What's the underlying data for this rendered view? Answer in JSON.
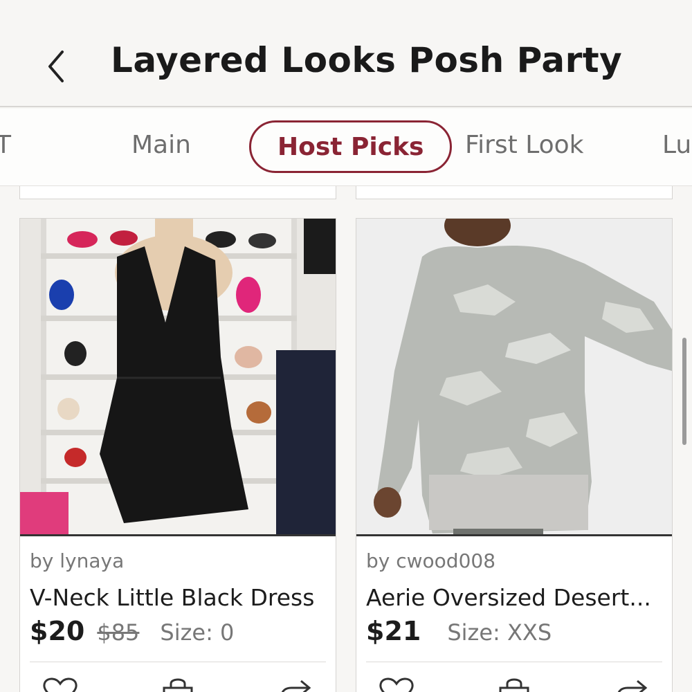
{
  "header": {
    "title": "Layered Looks Posh Party",
    "back_icon": "chevron-left-icon"
  },
  "tabs": [
    {
      "label": "T",
      "active": false
    },
    {
      "label": "Main",
      "active": false
    },
    {
      "label": "Host Picks",
      "active": true
    },
    {
      "label": "First Look",
      "active": false
    },
    {
      "label": "Lu",
      "active": false
    }
  ],
  "listings": [
    {
      "seller": "by lynaya",
      "title": "V-Neck Little Black Dress",
      "price": "$20",
      "original_price": "$85",
      "size": "Size: 0",
      "actions": [
        "heart-icon",
        "shopping-bag-icon",
        "share-icon"
      ]
    },
    {
      "seller": "by cwood008",
      "title": "Aerie Oversized Desert...",
      "price": "$21",
      "original_price": "",
      "size": "Size: XXS",
      "actions": [
        "heart-icon",
        "shopping-bag-icon",
        "share-icon"
      ]
    }
  ],
  "colors": {
    "accent": "#8a2434",
    "background": "#f7f6f4"
  }
}
